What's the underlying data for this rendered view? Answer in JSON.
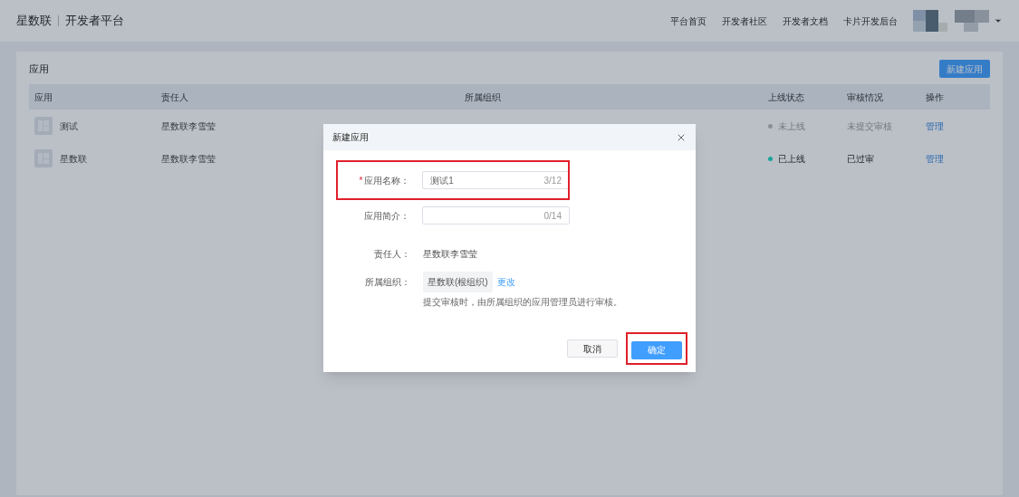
{
  "header": {
    "brand": "星数联",
    "platform": "开发者平台",
    "nav": [
      "平台首页",
      "开发者社区",
      "开发者文档",
      "卡片开发后台"
    ]
  },
  "card": {
    "title": "应用",
    "new_button": "新建应用"
  },
  "table": {
    "columns": [
      "应用",
      "责任人",
      "所属组织",
      "上线状态",
      "审核情况",
      "操作"
    ],
    "rows": [
      {
        "name": "测试",
        "owner": "星数联李雪莹",
        "status": {
          "text": "未上线",
          "color": "#8a8f99",
          "active": false
        },
        "review": {
          "text": "未提交审核",
          "active": false
        },
        "action": "管理"
      },
      {
        "name": "星数联",
        "owner": "星数联李雪莹",
        "status": {
          "text": "已上线",
          "color": "#1aa39a",
          "active": true
        },
        "review": {
          "text": "已过审",
          "active": true
        },
        "action": "管理"
      }
    ]
  },
  "modal": {
    "title": "新建应用",
    "name_field": {
      "label": "应用名称：",
      "required_mark": "*",
      "value": "测试1",
      "counter": "3/12",
      "highlighted": true
    },
    "intro_field": {
      "label": "应用简介：",
      "counter": "0/14",
      "highlighted": false
    },
    "owner": {
      "label": "责任人：",
      "value": "星数联李雪莹"
    },
    "org": {
      "label": "所属组织：",
      "value": "星数联(根组织)",
      "change": "更改",
      "hint": "提交审核时，由所属组织的应用管理员进行审核。"
    },
    "cancel": {
      "label": "取消"
    },
    "confirm": {
      "label": "确定",
      "highlighted": true
    }
  }
}
